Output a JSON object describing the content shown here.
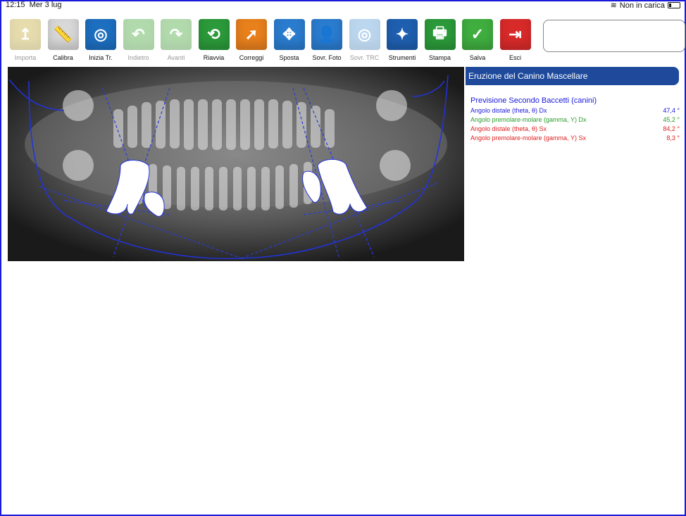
{
  "status": {
    "time": "12:15",
    "date": "Mer 3 lug",
    "wifi_icon": "wifi-icon",
    "charging": "Non in carica"
  },
  "toolbar": [
    {
      "label": "Importa",
      "icon": "folder-upload-icon",
      "color": "#c8b24a",
      "enabled": false
    },
    {
      "label": "Calibra",
      "icon": "ruler-icon",
      "color": "#d8d8d8",
      "enabled": true
    },
    {
      "label": "Inizia Tr.",
      "icon": "tracing-start-icon",
      "color": "#1d6fc0",
      "enabled": true
    },
    {
      "label": "Indietro",
      "icon": "undo-icon",
      "color": "#55b04a",
      "enabled": false
    },
    {
      "label": "Avanti",
      "icon": "redo-icon",
      "color": "#55b04a",
      "enabled": false
    },
    {
      "label": "Riavvia",
      "icon": "restart-icon",
      "color": "#2b9a3a",
      "enabled": true
    },
    {
      "label": "Correggi",
      "icon": "correct-icon",
      "color": "#e8801c",
      "enabled": true
    },
    {
      "label": "Sposta",
      "icon": "move-arrows-icon",
      "color": "#2a7ccf",
      "enabled": true
    },
    {
      "label": "Sovr. Foto",
      "icon": "photo-overlay-icon",
      "color": "#2a7ccf",
      "enabled": true
    },
    {
      "label": "Sovr. TRC",
      "icon": "trc-overlay-icon",
      "color": "#6aa6dc",
      "enabled": false
    },
    {
      "label": "Strumenti",
      "icon": "magic-wand-icon",
      "color": "#1f5fb0",
      "enabled": true
    },
    {
      "label": "Stampa",
      "icon": "printer-icon",
      "color": "#2b9a3a",
      "enabled": true
    },
    {
      "label": "Salva",
      "icon": "checkmark-icon",
      "color": "#3fae3f",
      "enabled": true
    },
    {
      "label": "Esci",
      "icon": "exit-icon",
      "color": "#d92a2a",
      "enabled": true
    }
  ],
  "panel": {
    "title": "Eruzione del Canino Mascellare",
    "subtitle": "Previsione Secondo Baccetti (canini)",
    "rows": [
      {
        "label": "Angolo distale (theta, θ) Dx",
        "value": "47,4 °",
        "color": "blue"
      },
      {
        "label": "Angolo premolare-molare (gamma, Υ) Dx",
        "value": "45,2 °",
        "color": "green"
      },
      {
        "label": "Angolo distale (theta, θ) Sx",
        "value": "84,2 °",
        "color": "red"
      },
      {
        "label": "Angolo premolare-molare (gamma, Υ) Sx",
        "value": "8,3 °",
        "color": "red"
      }
    ]
  },
  "glyphs": [
    "↥",
    "📏",
    "◎",
    "↶",
    "↷",
    "⟲",
    "➚",
    "✥",
    "👤",
    "◎",
    "✦",
    "🖶",
    "✓",
    "⇥"
  ]
}
